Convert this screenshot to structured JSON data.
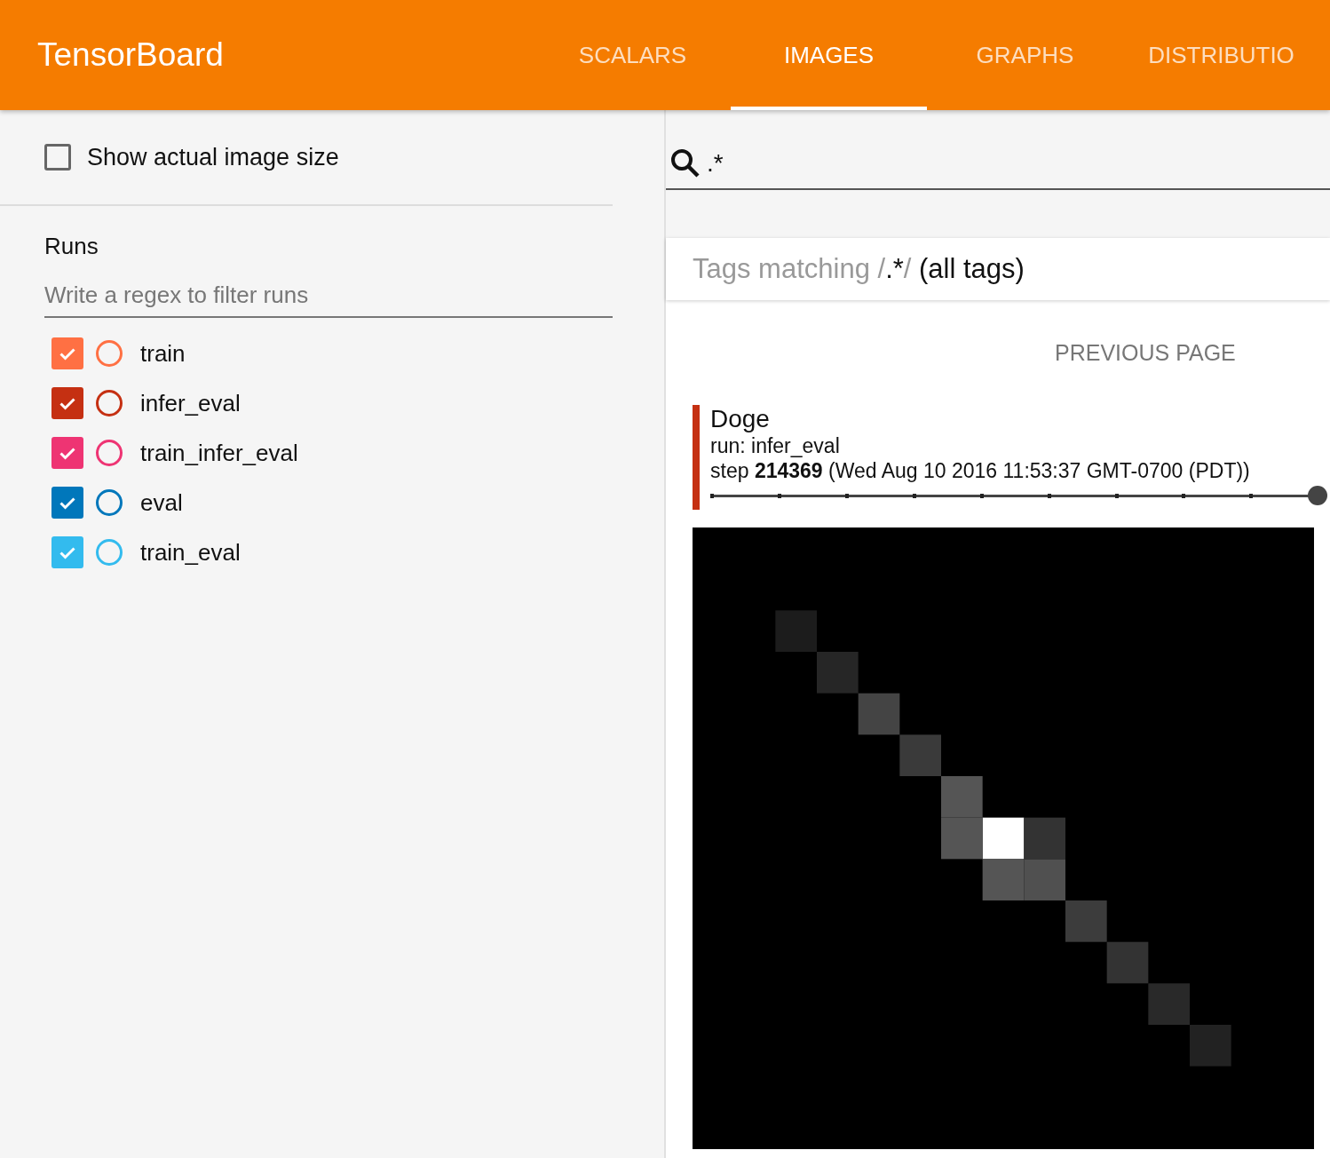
{
  "header": {
    "title": "TensorBoard",
    "tabs": [
      {
        "label": "SCALARS",
        "selected": false
      },
      {
        "label": "IMAGES",
        "selected": true
      },
      {
        "label": "GRAPHS",
        "selected": false
      },
      {
        "label": "DISTRIBUTIO",
        "selected": false
      }
    ]
  },
  "sidebar": {
    "show_actual_size": {
      "label": "Show actual image size",
      "checked": false
    },
    "runs_title": "Runs",
    "filter": {
      "placeholder": "Write a regex to filter runs"
    },
    "runs": [
      {
        "name": "train",
        "checked": true,
        "selected": false,
        "color": "#ff7043"
      },
      {
        "name": "infer_eval",
        "checked": true,
        "selected": false,
        "color": "#c53012"
      },
      {
        "name": "train_infer_eval",
        "checked": true,
        "selected": false,
        "color": "#ee3473"
      },
      {
        "name": "eval",
        "checked": true,
        "selected": false,
        "color": "#0077bb"
      },
      {
        "name": "train_eval",
        "checked": true,
        "selected": false,
        "color": "#33bbee"
      }
    ]
  },
  "main": {
    "search": {
      "value": ".*"
    },
    "tags_header": {
      "prefix": "Tags matching ",
      "pattern": "/.*/",
      "suffix": "(all tags)"
    },
    "previous_page": "PREVIOUS PAGE",
    "card": {
      "title": "Doge",
      "run": "run: infer_eval",
      "step": "step **214369** (Wed Aug 10 2016 11:53:37 GMT-0700 (PDT))",
      "color": "#c53012",
      "slider": {
        "level": 1
      }
    }
  }
}
